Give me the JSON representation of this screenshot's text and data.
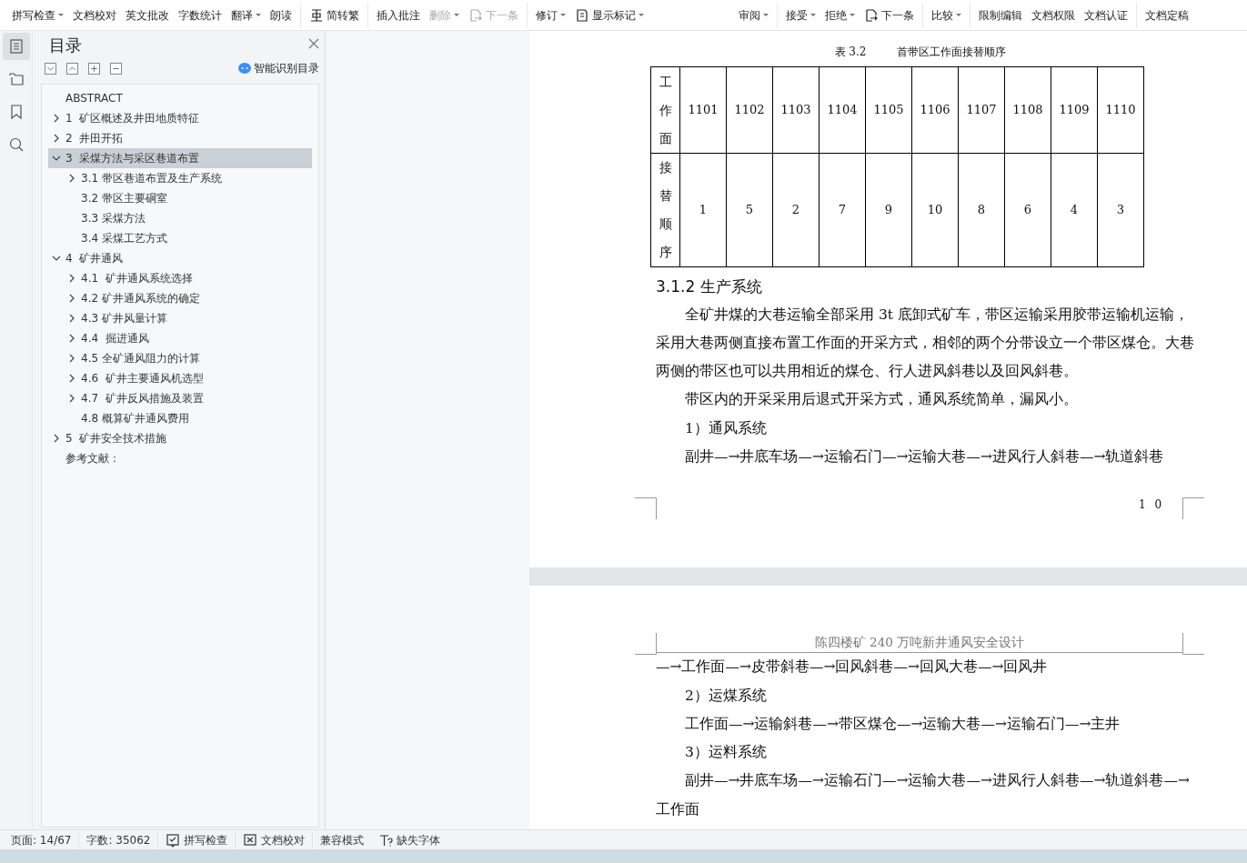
{
  "toolbar": {
    "groups": [
      [
        {
          "label": "拼写检查",
          "dropdown": true,
          "disabled": false
        },
        {
          "label": "文档校对",
          "dropdown": false,
          "disabled": false
        },
        {
          "label": "英文批改",
          "dropdown": false,
          "disabled": false
        },
        {
          "label": "字数统计",
          "dropdown": false,
          "disabled": false
        },
        {
          "label": "翻译",
          "dropdown": true,
          "disabled": false
        },
        {
          "label": "朗读",
          "dropdown": false,
          "disabled": false
        }
      ],
      [
        {
          "label": "简转繁",
          "dropdown": false,
          "disabled": false
        }
      ],
      [
        {
          "label": "插入批注",
          "dropdown": false,
          "disabled": false
        },
        {
          "label": "删除",
          "dropdown": true,
          "disabled": true
        },
        {
          "label": "下一条",
          "dropdown": false,
          "disabled": true
        }
      ],
      [
        {
          "label": "修订",
          "dropdown": true,
          "disabled": false
        },
        {
          "label": "显示标记",
          "dropdown": true,
          "disabled": false
        }
      ],
      [
        {
          "label": "审阅",
          "dropdown": true,
          "disabled": false
        }
      ],
      [
        {
          "label": "接受",
          "dropdown": true,
          "disabled": false
        },
        {
          "label": "拒绝",
          "dropdown": true,
          "disabled": false
        },
        {
          "label": "下一条",
          "dropdown": false,
          "disabled": false
        }
      ],
      [
        {
          "label": "比较",
          "dropdown": true,
          "disabled": false
        }
      ],
      [
        {
          "label": "限制编辑",
          "dropdown": false,
          "disabled": false
        },
        {
          "label": "文档权限",
          "dropdown": false,
          "disabled": false
        },
        {
          "label": "文档认证",
          "dropdown": false,
          "disabled": false
        }
      ],
      [
        {
          "label": "文档定稿",
          "dropdown": false,
          "disabled": false
        }
      ]
    ]
  },
  "rail": [
    {
      "selected": true
    },
    {
      "selected": false
    },
    {
      "selected": false
    },
    {
      "selected": false
    }
  ],
  "toc": {
    "title": "目录",
    "smart_link": "智能识别目录",
    "items": [
      {
        "label": "ABSTRACT",
        "selected": false
      },
      {
        "label": "1  矿区概述及井田地质特征",
        "selected": false,
        "expanded": false
      },
      {
        "label": "2  井田开拓",
        "selected": false,
        "expanded": false
      },
      {
        "label": "3  采煤方法与采区巷道布置",
        "selected": true,
        "expanded": true,
        "children": [
          {
            "label": "3.1 带区巷道布置及生产系统",
            "selected": false,
            "expanded": false
          },
          {
            "label": "3.2 带区主要硐室",
            "selected": false
          },
          {
            "label": "3.3 采煤方法",
            "selected": false
          },
          {
            "label": "3.4 采煤工艺方式",
            "selected": false
          }
        ]
      },
      {
        "label": "4  矿井通风",
        "selected": false,
        "expanded": true,
        "children": [
          {
            "label": "4.1  矿井通风系统选择",
            "selected": false,
            "expanded": false
          },
          {
            "label": "4.2 矿井通风系统的确定",
            "selected": false,
            "expanded": false
          },
          {
            "label": "4.3 矿井风量计算",
            "selected": false,
            "expanded": false
          },
          {
            "label": "4.4  掘进通风",
            "selected": false,
            "expanded": false
          },
          {
            "label": "4.5 全矿通风阻力的计算",
            "selected": false,
            "expanded": false
          },
          {
            "label": "4.6  矿井主要通风机选型",
            "selected": false,
            "expanded": false
          },
          {
            "label": "4.7  矿井反风措施及装置",
            "selected": false,
            "expanded": false
          },
          {
            "label": "4.8 概算矿井通风费用",
            "selected": false
          }
        ]
      },
      {
        "label": "5  矿井安全技术措施",
        "selected": false,
        "expanded": false
      },
      {
        "label": "参考文献：",
        "selected": false
      }
    ]
  },
  "document": {
    "page1": {
      "table_caption": {
        "number": "表 3.2",
        "title": "首带区工作面接替顺序"
      },
      "table": {
        "rows": [
          {
            "header": "工作面",
            "cells": [
              "1101",
              "1102",
              "1103",
              "1104",
              "1105",
              "1106",
              "1107",
              "1108",
              "1109",
              "1110"
            ]
          },
          {
            "header": "接替顺序",
            "cells": [
              "1",
              "5",
              "2",
              "7",
              "9",
              "10",
              "8",
              "6",
              "4",
              "3"
            ]
          }
        ]
      },
      "heading": "3.1.2 生产系统",
      "paragraphs": [
        {
          "text": "全矿井煤的大巷运输全部采用 3t 底卸式矿车，带区运输采用胶带运输机运输，采用大巷两侧直接布置工作面的开采方式，相邻的两个分带设立一个带区煤仓。大巷两侧的带区也可以共用相近的煤仓、行人进风斜巷以及回风斜巷。",
          "indent": true
        },
        {
          "text": "带区内的开采采用后退式开采方式，通风系统简单，漏风小。",
          "indent": true
        },
        {
          "text": "1）通风系统",
          "indent": true
        },
        {
          "text": "副井—→井底车场—→运输石门—→运输大巷—→进风行人斜巷—→轨道斜巷",
          "indent": true
        }
      ],
      "page_number": "1 0"
    },
    "page2": {
      "header": "陈四楼矿 240 万吨新井通风安全设计",
      "paragraphs": [
        {
          "text": "—→工作面—→皮带斜巷—→回风斜巷—→回风大巷—→回风井",
          "indent": false
        },
        {
          "text": "2）运煤系统",
          "indent": true
        },
        {
          "text": "工作面—→运输斜巷—→带区煤仓—→运输大巷—→运输石门—→主井",
          "indent": true
        },
        {
          "text": "3）运料系统",
          "indent": true
        },
        {
          "text": "副井—→井底车场—→运输石门—→运输大巷—→进风行人斜巷—→轨道斜巷—→工作面",
          "indent": true
        }
      ]
    }
  },
  "status_bar": [
    {
      "label": "页面: 14/67",
      "kind": "text"
    },
    {
      "label": "字数: 35062",
      "kind": "text"
    },
    {
      "label": "拼写检查",
      "kind": "check"
    },
    {
      "label": "文档校对",
      "kind": "cross"
    },
    {
      "label": "兼容模式",
      "kind": "text"
    },
    {
      "label": "缺失字体",
      "kind": "font"
    }
  ]
}
